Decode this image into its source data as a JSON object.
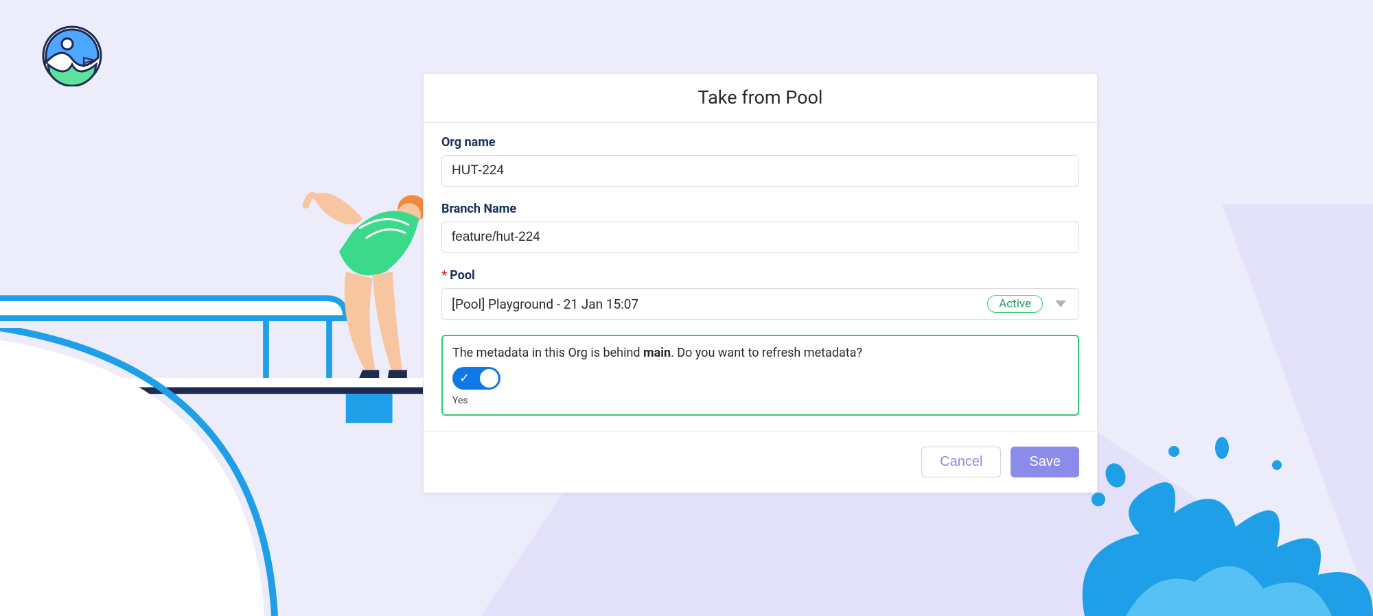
{
  "dialog": {
    "title": "Take from Pool",
    "fields": {
      "org_name": {
        "label": "Org name",
        "value": "HUT-224"
      },
      "branch_name": {
        "label": "Branch Name",
        "value": "feature/hut-224"
      },
      "pool": {
        "label": "Pool",
        "required": true,
        "selected": "[Pool] Playground - 21 Jan 15:07",
        "status_badge": "Active"
      }
    },
    "refresh_prompt": {
      "prefix": "The metadata in this Org is behind ",
      "bold": "main",
      "suffix": ". Do you want to refresh metadata?",
      "toggle_state_label": "Yes"
    },
    "buttons": {
      "cancel": "Cancel",
      "save": "Save"
    }
  }
}
